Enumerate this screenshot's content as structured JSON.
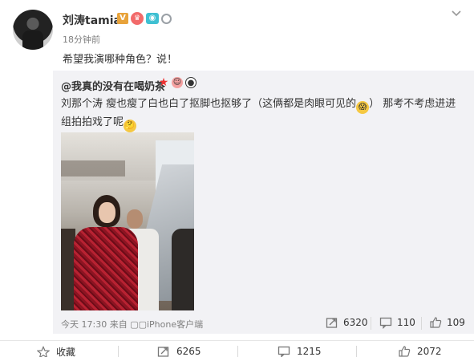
{
  "post": {
    "username": "刘涛tamia",
    "timestamp": "18分钟前",
    "text": "希望我演哪种角色？说！",
    "badges": [
      "verified-v-icon",
      "vip-icon",
      "camera-icon",
      "ring-icon"
    ]
  },
  "repost": {
    "author": "@我真的没有在喝奶茶",
    "text_part1": "刘那个涛 瘦也瘦了白也白了抠脚也抠够了（这俩都是肉眼可见的",
    "text_part2": "） 那考不考虑进进组拍拍戏了呢",
    "meta": "今天 17:30 来自 ▢▢iPhone客户端",
    "actions": {
      "forward_count": "6320",
      "comment_count": "110",
      "like_count": "109"
    }
  },
  "footer": {
    "favorite_label": "收藏",
    "forward_count": "6265",
    "comment_count": "1215",
    "like_count": "2072"
  },
  "colors": {
    "link": "#333333",
    "meta": "#808080",
    "repost_bg": "#f2f2f5",
    "accent_orange": "#e8a33b"
  }
}
